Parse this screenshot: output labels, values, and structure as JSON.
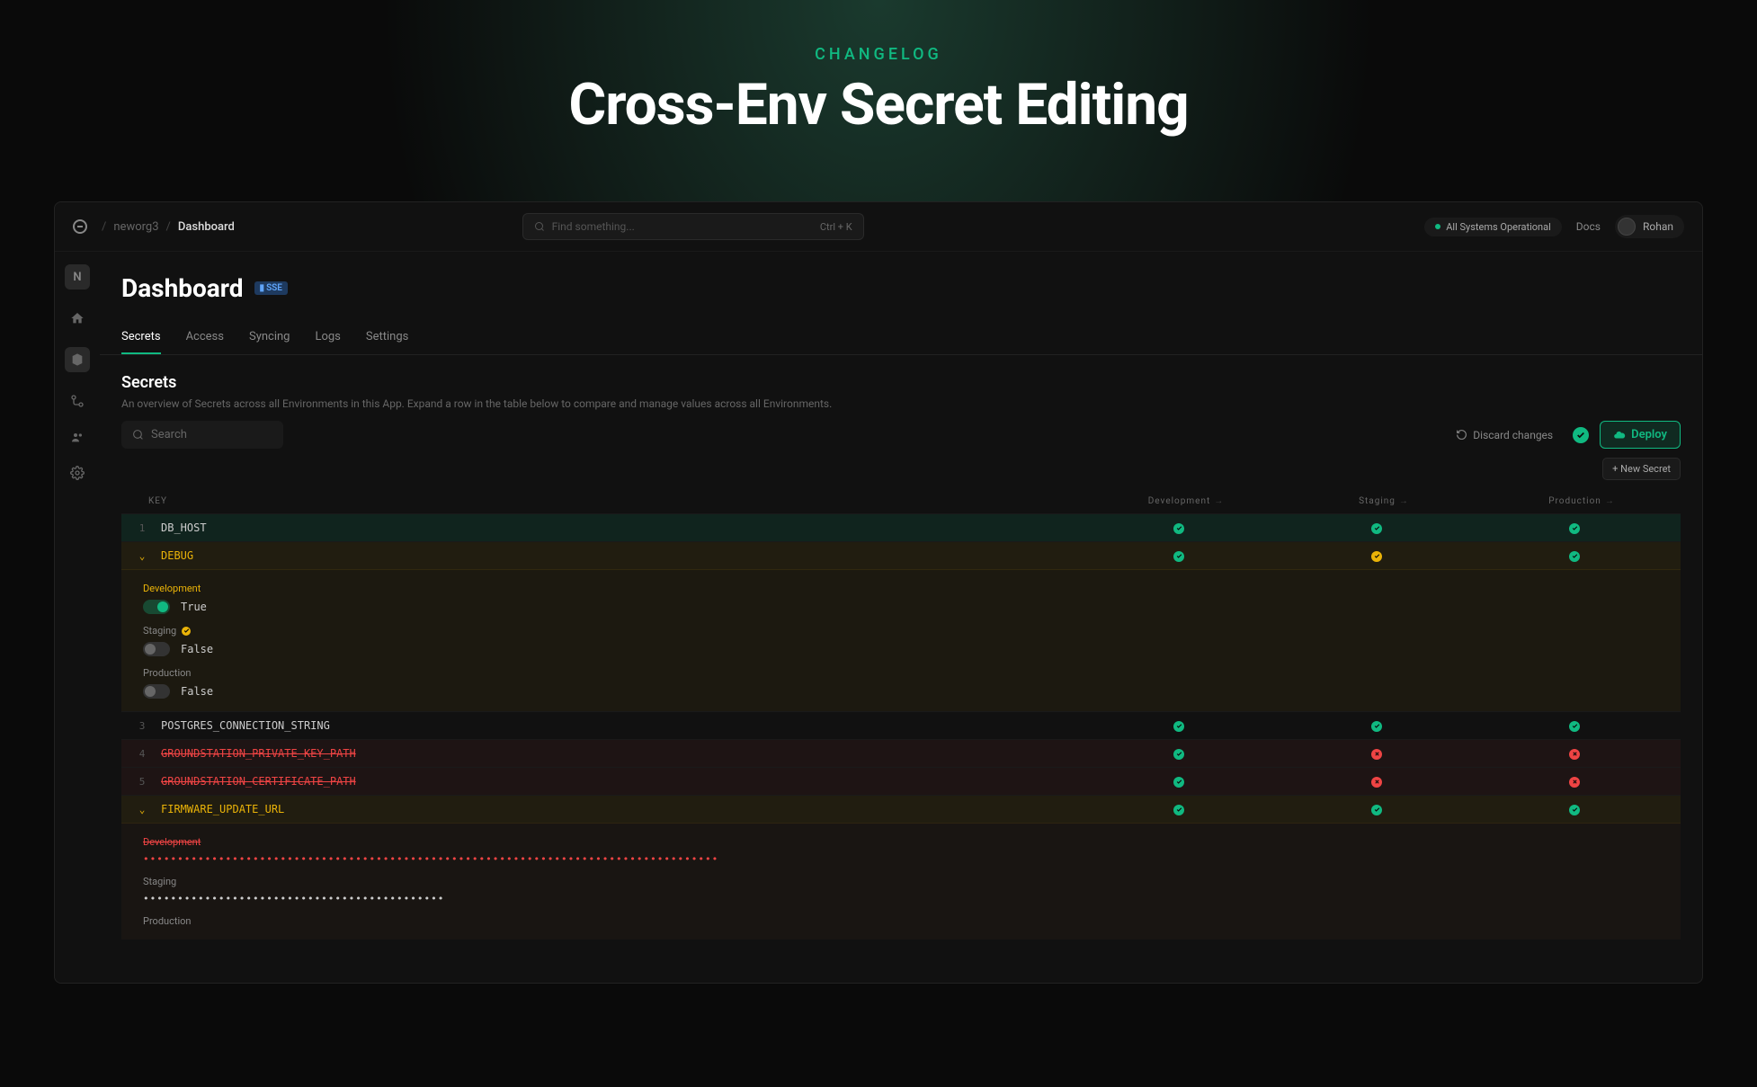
{
  "hero": {
    "label": "CHANGELOG",
    "title": "Cross-Env Secret Editing"
  },
  "breadcrumb": {
    "org": "neworg3",
    "current": "Dashboard"
  },
  "search": {
    "placeholder": "Find something...",
    "shortcut": "Ctrl + K"
  },
  "status": {
    "text": "All Systems Operational"
  },
  "docs": "Docs",
  "user": {
    "name": "Rohan"
  },
  "sidebar": {
    "org_initial": "N"
  },
  "page": {
    "title": "Dashboard",
    "badge": "SSE"
  },
  "tabs": [
    "Secrets",
    "Access",
    "Syncing",
    "Logs",
    "Settings"
  ],
  "section": {
    "title": "Secrets",
    "desc": "An overview of Secrets across all Environments in this App. Expand a row in the table below to compare and manage values across all Environments."
  },
  "search_local": {
    "placeholder": "Search"
  },
  "actions": {
    "discard": "Discard changes",
    "deploy": "Deploy",
    "new_secret": "+ New Secret"
  },
  "table": {
    "key_header": "KEY",
    "envs": [
      "Development",
      "Staging",
      "Production"
    ],
    "rows": [
      {
        "n": "1",
        "key": "DB_HOST",
        "status": [
          "ok",
          "ok",
          "ok"
        ],
        "variant": "green"
      },
      {
        "n": "",
        "key": "DEBUG",
        "status": [
          "ok",
          "warn",
          "ok"
        ],
        "variant": "yellow",
        "expanded": true
      },
      {
        "n": "3",
        "key": "POSTGRES_CONNECTION_STRING",
        "status": [
          "ok",
          "ok",
          "ok"
        ],
        "variant": ""
      },
      {
        "n": "4",
        "key": "GROUNDSTATION_PRIVATE_KEY_PATH",
        "status": [
          "ok",
          "err",
          "err"
        ],
        "variant": "red"
      },
      {
        "n": "5",
        "key": "GROUNDSTATION_CERTIFICATE_PATH",
        "status": [
          "ok",
          "err",
          "err"
        ],
        "variant": "red"
      },
      {
        "n": "",
        "key": "FIRMWARE_UPDATE_URL",
        "status": [
          "ok",
          "ok",
          "ok"
        ],
        "variant": "yellow",
        "expanded": true
      }
    ]
  },
  "debug_panel": {
    "envs": [
      {
        "label": "Development",
        "value": "True",
        "toggle": true,
        "label_variant": "yellow"
      },
      {
        "label": "Staging",
        "value": "False",
        "toggle": false,
        "warn": true
      },
      {
        "label": "Production",
        "value": "False",
        "toggle": false
      }
    ]
  },
  "firmware_panel": {
    "envs": [
      {
        "label": "Development",
        "label_variant": "red",
        "mask_variant": "red"
      },
      {
        "label": "Staging",
        "mask_variant": "white"
      },
      {
        "label": "Production"
      }
    ]
  }
}
